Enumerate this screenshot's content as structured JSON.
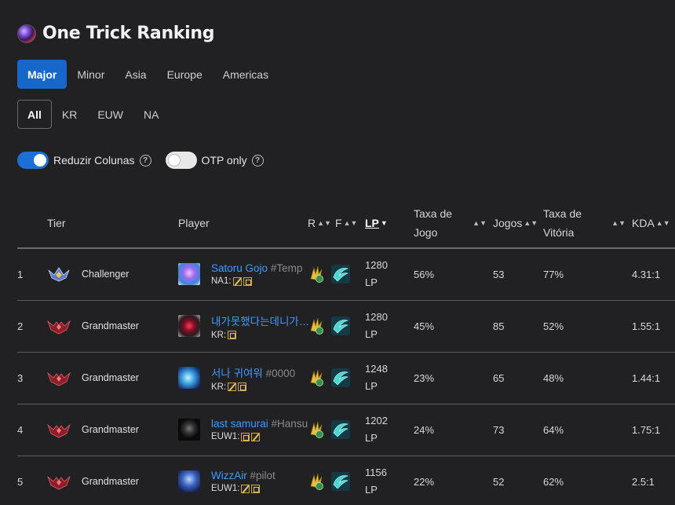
{
  "header": {
    "title": "One Trick Ranking"
  },
  "region_tabs": [
    {
      "label": "Major",
      "active": true
    },
    {
      "label": "Minor",
      "active": false
    },
    {
      "label": "Asia",
      "active": false
    },
    {
      "label": "Europe",
      "active": false
    },
    {
      "label": "Americas",
      "active": false
    }
  ],
  "server_tabs": [
    {
      "label": "All",
      "active": true
    },
    {
      "label": "KR",
      "active": false
    },
    {
      "label": "EUW",
      "active": false
    },
    {
      "label": "NA",
      "active": false
    }
  ],
  "toggles": {
    "reduce_columns": {
      "label": "Reduzir Colunas",
      "on": true
    },
    "otp_only": {
      "label": "OTP only",
      "on": false
    },
    "help_glyph": "?"
  },
  "table": {
    "headers": {
      "tier": "Tier",
      "player": "Player",
      "r": "R",
      "f": "F",
      "lp": "LP",
      "taxa_jogo_1": "Taxa de",
      "taxa_jogo_2": "Jogo",
      "jogos": "Jogos",
      "taxa_vitoria_1": "Taxa de",
      "taxa_vitoria_2": "Vitória",
      "kda": "KDA"
    },
    "rows": [
      {
        "rank": "1",
        "tier": "Challenger",
        "name": "Satoru Gojo",
        "tag": "#Temp",
        "server": "NA1:",
        "lp1": "1280",
        "lp2": "LP",
        "taxa_jogo": "56%",
        "jogos": "53",
        "taxa_vitoria": "77%",
        "kda": "4.31:1"
      },
      {
        "rank": "2",
        "tier": "Grandmaster",
        "name": "내가못했다는데니가…",
        "tag": "",
        "server": "KR:",
        "lp1": "1280",
        "lp2": "LP",
        "taxa_jogo": "45%",
        "jogos": "85",
        "taxa_vitoria": "52%",
        "kda": "1.55:1"
      },
      {
        "rank": "3",
        "tier": "Grandmaster",
        "name": "서나 귀여워",
        "tag": "#0000",
        "server": "KR:",
        "lp1": "1248",
        "lp2": "LP",
        "taxa_jogo": "23%",
        "jogos": "65",
        "taxa_vitoria": "48%",
        "kda": "1.44:1"
      },
      {
        "rank": "4",
        "tier": "Grandmaster",
        "name": "last samurai",
        "tag": "#Hansu",
        "server": "EUW1:",
        "lp1": "1202",
        "lp2": "LP",
        "taxa_jogo": "24%",
        "jogos": "73",
        "taxa_vitoria": "64%",
        "kda": "1.75:1"
      },
      {
        "rank": "5",
        "tier": "Grandmaster",
        "name": "WizzAir",
        "tag": "#pilot",
        "server": "EUW1:",
        "lp1": "1156",
        "lp2": "LP",
        "taxa_jogo": "22%",
        "jogos": "52",
        "taxa_vitoria": "62%",
        "kda": "2.5:1"
      }
    ]
  },
  "colors": {
    "accent": "#1667c9",
    "link": "#3d9bff",
    "background": "#212124"
  }
}
